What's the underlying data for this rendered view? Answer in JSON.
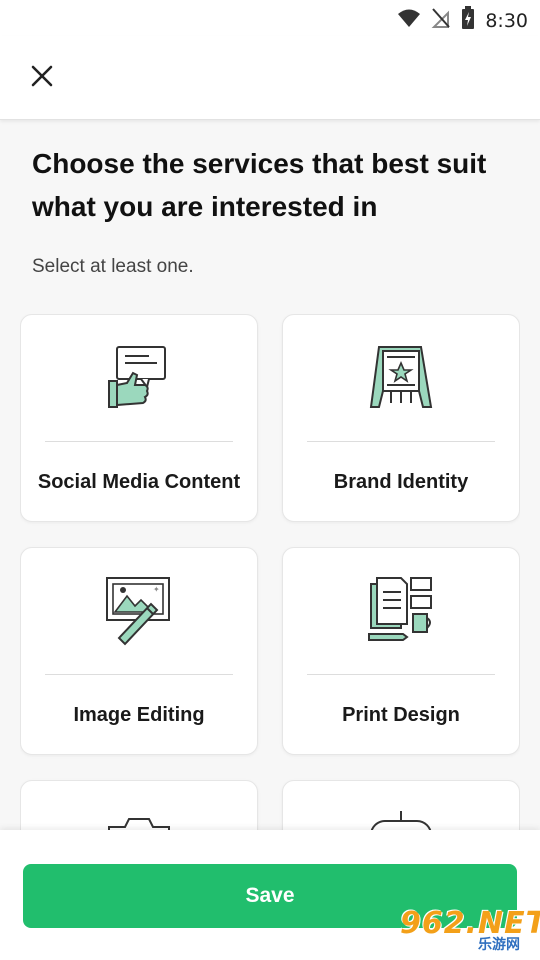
{
  "status_bar": {
    "time": "8:30",
    "icons": [
      "wifi-icon",
      "no-signal-icon",
      "battery-charging-icon"
    ]
  },
  "header": {
    "close_icon": "close-icon"
  },
  "main": {
    "title": "Choose the services that best suit what you are interested in",
    "subtitle": "Select at least one.",
    "services": [
      {
        "label": "Social Media Content",
        "icon": "social-media-icon"
      },
      {
        "label": "Brand Identity",
        "icon": "brand-identity-icon"
      },
      {
        "label": "Image Editing",
        "icon": "image-editing-icon"
      },
      {
        "label": "Print Design",
        "icon": "print-design-icon"
      },
      {
        "label": "",
        "icon": "camera-icon"
      },
      {
        "label": "",
        "icon": "gamepad-icon"
      }
    ]
  },
  "footer": {
    "save_label": "Save"
  },
  "watermark": {
    "brand": "962.NET",
    "sub": "乐游网"
  },
  "colors": {
    "accent": "#21be6d",
    "icon_green": "#9bd8bd",
    "icon_stroke": "#333333"
  }
}
